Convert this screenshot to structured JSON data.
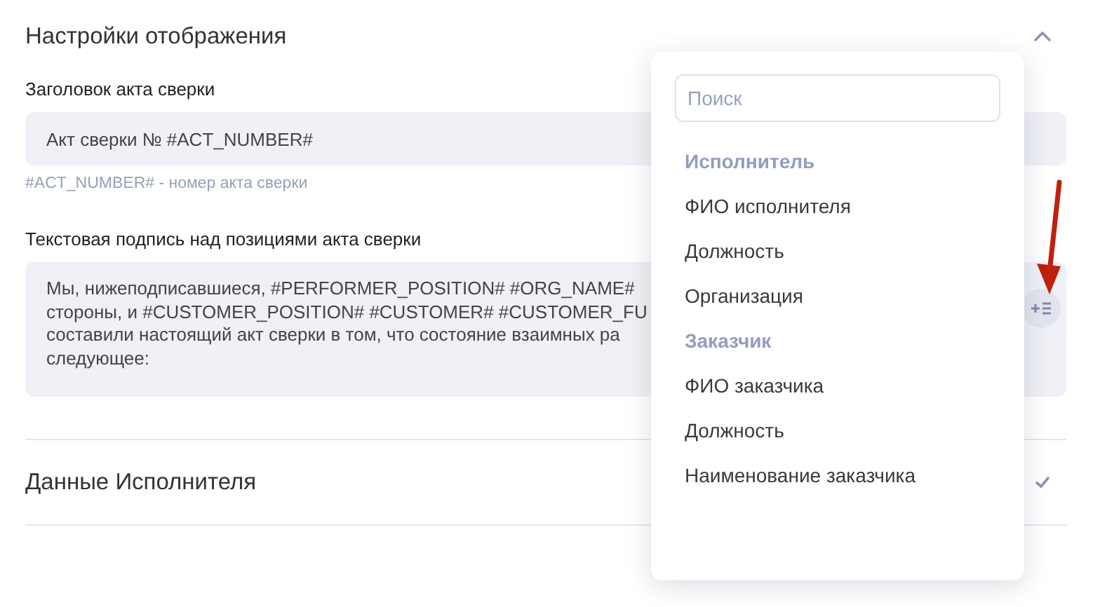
{
  "sections": [
    {
      "title": "Настройки отображения",
      "expanded": true,
      "fields": [
        {
          "kind": "input",
          "label": "Заголовок акта сверки",
          "value": "Акт сверки № #ACT_NUMBER#",
          "hint": "#ACT_NUMBER# - номер акта сверки"
        },
        {
          "kind": "textarea",
          "label": "Текстовая подпись над позициями акта сверки",
          "lines": [
            "Мы, нижеподписавшиеся, #PERFORMER_POSITION# #ORG_NAME#",
            "стороны, и #CUSTOMER_POSITION# #CUSTOMER# #CUSTOMER_FU",
            "составили настоящий акт сверки в том, что состояние взаимных ра",
            "следующее:"
          ]
        }
      ]
    },
    {
      "title": "Данные Исполнителя",
      "expanded": false
    }
  ],
  "dropdown": {
    "search": {
      "placeholder": "Поиск"
    },
    "items": [
      {
        "kind": "group",
        "label": "Исполнитель"
      },
      {
        "kind": "option",
        "label": "ФИО исполнителя"
      },
      {
        "kind": "option",
        "label": "Должность"
      },
      {
        "kind": "option",
        "label": "Организация"
      },
      {
        "kind": "group",
        "label": "Заказчик"
      },
      {
        "kind": "option",
        "label": "ФИО заказчика"
      },
      {
        "kind": "option",
        "label": "Должность"
      },
      {
        "kind": "option",
        "label": "Наименование заказчика"
      }
    ]
  }
}
